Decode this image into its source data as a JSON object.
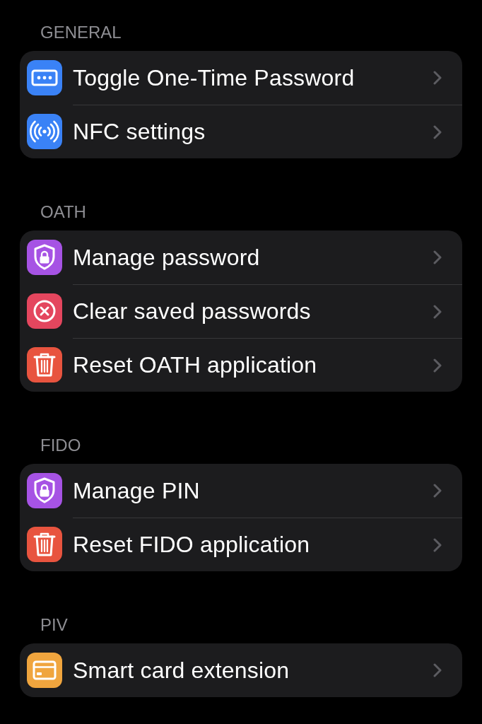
{
  "sections": [
    {
      "header": "GENERAL",
      "items": [
        {
          "label": "Toggle One-Time Password",
          "color": "#3a82f6"
        },
        {
          "label": "NFC settings",
          "color": "#3a82f6"
        }
      ]
    },
    {
      "header": "OATH",
      "items": [
        {
          "label": "Manage password",
          "color": "#a653e4"
        },
        {
          "label": "Clear saved passwords",
          "color": "#e4465e"
        },
        {
          "label": "Reset OATH application",
          "color": "#e8543f"
        }
      ]
    },
    {
      "header": "FIDO",
      "items": [
        {
          "label": "Manage PIN",
          "color": "#a653e4"
        },
        {
          "label": "Reset FIDO application",
          "color": "#e8543f"
        }
      ]
    },
    {
      "header": "PIV",
      "items": [
        {
          "label": "Smart card extension",
          "color": "#f0a53e"
        }
      ]
    }
  ]
}
